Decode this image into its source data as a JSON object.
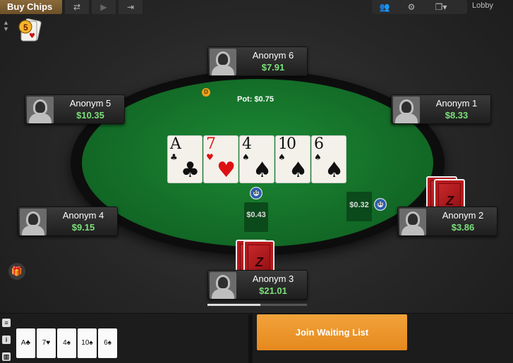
{
  "topbar": {
    "buy_chips": "Buy Chips",
    "lobby": "Lobby",
    "icons": [
      "refresh-icon",
      "play-icon",
      "exit-icon",
      "players-icon",
      "gear-icon",
      "window-icon"
    ]
  },
  "table": {
    "pot": "Pot: $0.75",
    "dealer": "D"
  },
  "board": [
    {
      "rank": "A",
      "suit": "♣",
      "red": false
    },
    {
      "rank": "7",
      "suit": "♥",
      "red": true
    },
    {
      "rank": "4",
      "suit": "♠",
      "red": false
    },
    {
      "rank": "10",
      "suit": "♠",
      "red": false
    },
    {
      "rank": "6",
      "suit": "♠",
      "red": false
    }
  ],
  "bets": {
    "player3": "$0.43",
    "player2": "$0.32"
  },
  "players": [
    {
      "name": "Anonym 6",
      "stack": "$7.91"
    },
    {
      "name": "Anonym 5",
      "stack": "$10.35"
    },
    {
      "name": "Anonym 1",
      "stack": "$8.33"
    },
    {
      "name": "Anonym 4",
      "stack": "$9.15"
    },
    {
      "name": "Anonym 2",
      "stack": "$3.86"
    },
    {
      "name": "Anonym 3",
      "stack": "$21.01"
    }
  ],
  "hand_history": [
    "A♣",
    "7♥",
    "4♠",
    "10♠",
    "6♠"
  ],
  "join_waiting_list": "Join Waiting List"
}
